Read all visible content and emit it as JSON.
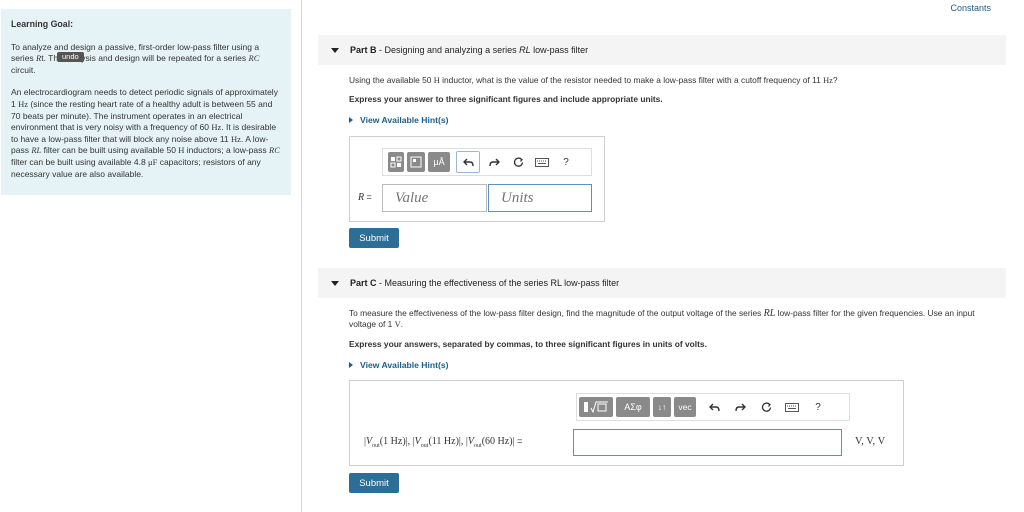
{
  "header": {
    "constants_label": "Constants"
  },
  "learning_goal": {
    "title": "Learning Goal:",
    "intro_a": "To analyze and design a passive, first-order low-pass filter using a series ",
    "intro_R": "R",
    "intro_b": "t. The analysis and design will be repeated for a series ",
    "intro_RC": "RC",
    "intro_c": " circuit.",
    "tooltip": "undo",
    "body_1": "An electrocardiogram needs to detect periodic signals of approximately 1 ",
    "unit_Hz": "Hz",
    "body_2": " (since the resting heart rate of a healthy adult is between 55 and 70 beats per minute). The instrument operates in an electrical environment that is very noisy with a frequency of 60 ",
    "body_3": ". It is desirable to have a low-pass filter that will block any noise above 11 ",
    "body_4": ". A low-pass ",
    "RL": "RL",
    "body_5": " filter can be built using available 50 ",
    "unit_H": "H",
    "body_6": " inductors; a low-pass ",
    "body_7": " filter can be built using available 4.8 ",
    "unit_uF": "μF",
    "body_8": " capacitors; resistors of any necessary value are also available."
  },
  "part_b": {
    "part_label": "Part B",
    "dash": " - ",
    "title_a": "Designing and analyzing a series ",
    "title_RL": "RL",
    "title_b": " low-pass filter",
    "question_a": "Using the available 50 ",
    "unit_H": "H",
    "question_b": " inductor, what is the value of the resistor needed to make a low-pass filter with a cutoff frequency of 11 ",
    "unit_Hz": "Hz",
    "question_c": "?",
    "instruction": "Express your answer to three significant figures and include appropriate units.",
    "hint_label": "View Available Hint(s)",
    "toolbar": {
      "mu_label": "μÅ",
      "help_label": "?"
    },
    "answer_var": "R",
    "equals": " =",
    "value_placeholder": "Value",
    "units_placeholder": "Units",
    "submit_label": "Submit"
  },
  "part_c": {
    "part_label": "Part C",
    "dash": " - ",
    "title": "Measuring the effectiveness of the series RL low-pass filter",
    "question_a": "To measure the effectiveness of the low-pass filter design, find the magnitude of the output voltage of the series ",
    "question_RL": "RL",
    "question_b": " low-pass filter for the given frequencies. Use an input voltage of 1 ",
    "unit_V": "V",
    "question_c": ".",
    "instruction": "Express your answers, separated by commas, to three significant figures in units of volts.",
    "hint_label": "View Available Hint(s)",
    "toolbar": {
      "greek_label": "ΑΣφ",
      "sort_label": "↓↑",
      "vec_label": "vec",
      "help_label": "?"
    },
    "vout_1": "1 Hz",
    "vout_2": "11 Hz",
    "vout_3": "60 Hz",
    "units_display": "V, V, V",
    "submit_label": "Submit"
  }
}
